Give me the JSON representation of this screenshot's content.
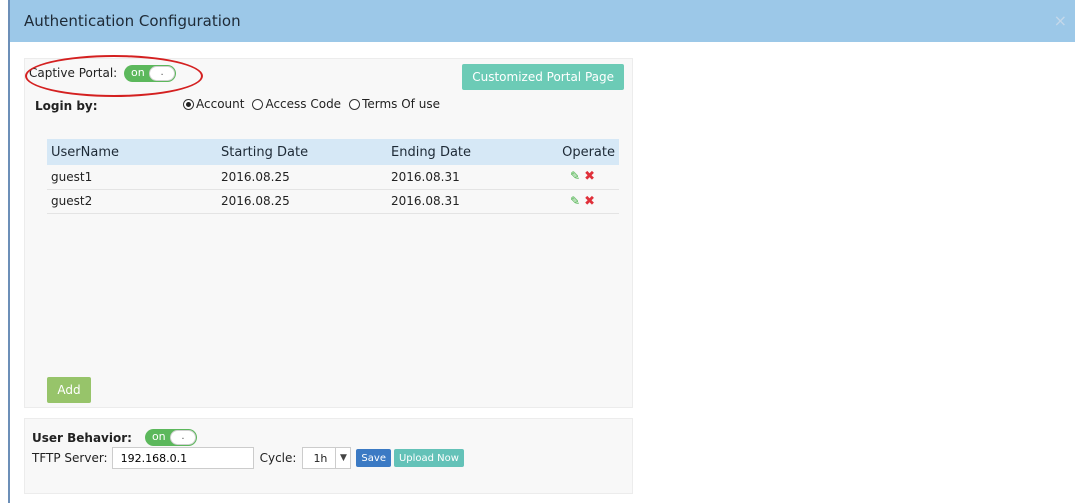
{
  "dialog": {
    "title": "Authentication Configuration",
    "close_icon": "×"
  },
  "captive_portal": {
    "label": "Captive Portal:",
    "toggle_text": "on",
    "toggle_knob": "."
  },
  "customized_portal_button": "Customized Portal Page",
  "login": {
    "label": "Login by:",
    "options": [
      {
        "label": "Account",
        "checked": true
      },
      {
        "label": "Access Code",
        "checked": false
      },
      {
        "label": "Terms Of use",
        "checked": false
      }
    ]
  },
  "table": {
    "headers": [
      "UserName",
      "Starting Date",
      "Ending Date",
      "Operate"
    ],
    "rows": [
      {
        "username": "guest1",
        "start": "2016.08.25",
        "end": "2016.08.31"
      },
      {
        "username": "guest2",
        "start": "2016.08.25",
        "end": "2016.08.31"
      }
    ],
    "edit_icon": "✎",
    "delete_icon": "✖"
  },
  "add_button": "Add",
  "user_behavior": {
    "label": "User Behavior:",
    "toggle_text": "on",
    "toggle_knob": ".",
    "tftp_label": "TFTP Server:",
    "tftp_value": "192.168.0.1",
    "cycle_label": "Cycle:",
    "cycle_value": "1h",
    "save_button": "Save",
    "upload_button": "Upload Now"
  },
  "colors": {
    "titlebar": "#9cc8e8",
    "toggle_on": "#5cb85c",
    "highlight_circle": "#d42020",
    "portal_button": "#6ccbb6",
    "add_button": "#97c46a"
  }
}
